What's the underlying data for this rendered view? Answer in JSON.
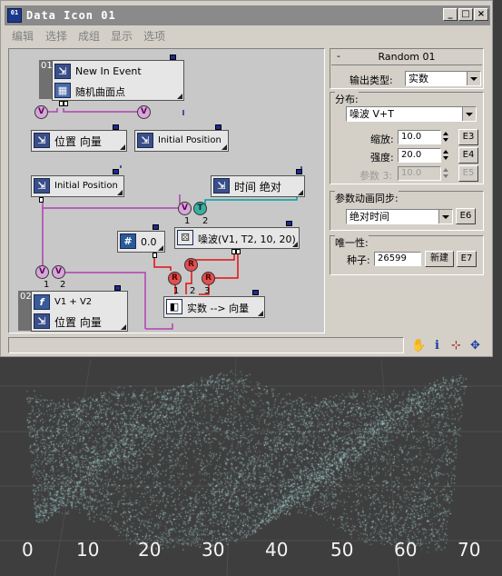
{
  "window": {
    "title": "Data Icon 01",
    "app_icon": "01",
    "controls": [
      "_",
      "□",
      "×"
    ]
  },
  "menu": [
    "编辑",
    "选择",
    "成组",
    "显示",
    "选项"
  ],
  "graph": {
    "group1": {
      "number": "01",
      "event": "New In Event",
      "source": "随机曲面点",
      "op_position_vector": "位置 向量",
      "op_initial_position": "Initial Position"
    },
    "initial_position": "Initial Position",
    "time_absolute": "时间 绝对",
    "scalar_value": "0.0",
    "noise": "噪波(V1, T2, 10, 20)",
    "convert": "实数 --> 向量",
    "group2": {
      "number": "02",
      "function": "V1 + V2",
      "output": "位置 向量"
    },
    "ports": {
      "v": "V",
      "t": "T",
      "r": "R",
      "one": "1",
      "two": "2",
      "three": "3"
    }
  },
  "panel": {
    "collapse": "-",
    "title": "Random 01",
    "output_type_label": "输出类型:",
    "output_type_value": "实数",
    "distribution_label": "分布:",
    "distribution_value": "噪波 V+T",
    "scale_label": "缩放:",
    "scale_value": "10.0",
    "scale_btn": "E3",
    "strength_label": "强度:",
    "strength_value": "20.0",
    "strength_btn": "E4",
    "param3_label": "参数 3:",
    "param3_value": "10.0",
    "param3_btn": "E5",
    "anim_sync_label": "参数动画同步:",
    "anim_sync_value": "绝对时间",
    "anim_sync_btn": "E6",
    "uniqueness_label": "唯一性:",
    "seed_label": "种子:",
    "seed_value": "26599",
    "new_btn": "新建",
    "seed_btn": "E7"
  },
  "statusbar": {
    "icons": [
      "hand-icon",
      "info-icon",
      "region-zoom-icon",
      "move-icon"
    ],
    "hand": "✋",
    "info": "i",
    "region": "⊹",
    "move": "✥"
  },
  "viewport": {
    "axis_labels": [
      "0",
      "10",
      "20",
      "30",
      "40",
      "50",
      "60",
      "70"
    ]
  },
  "colors": {
    "particles": "#bff2f2",
    "wire_purple": "#b040b0",
    "wire_red": "#e01010",
    "wire_teal": "#00a0a0",
    "link_dark": "#1a2a9a"
  }
}
